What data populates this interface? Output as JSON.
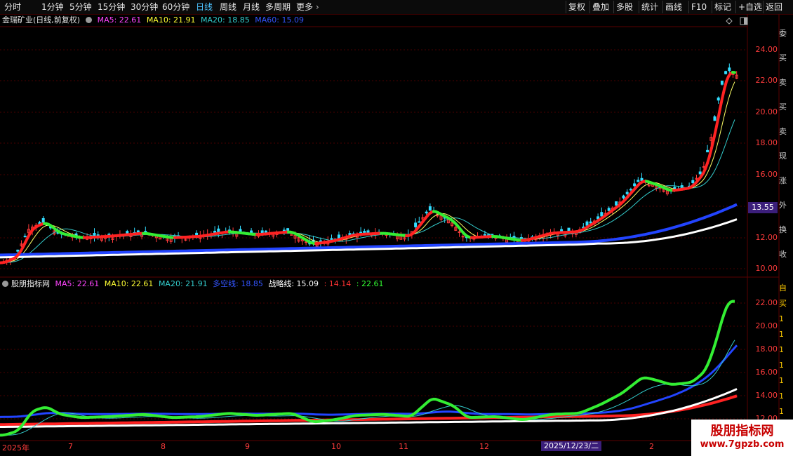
{
  "toolbar": {
    "tabs": [
      "分时",
      "1分钟",
      "5分钟",
      "15分钟",
      "30分钟",
      "60分钟",
      "日线",
      "周线",
      "月线",
      "多周期",
      "更多"
    ],
    "active_tab": "日线",
    "right_buttons": [
      "复权",
      "叠加",
      "多股",
      "统计",
      "画线",
      "F10",
      "标记",
      "+自选",
      "返回"
    ]
  },
  "main_legend": {
    "title": "金瑞矿业(日线,前复权)",
    "items": [
      {
        "text": "MA5: 22.61",
        "color": "#ff44ff"
      },
      {
        "text": "MA10: 21.91",
        "color": "#ffff33"
      },
      {
        "text": "MA20: 18.85",
        "color": "#33cccc"
      },
      {
        "text": "MA60: 15.09",
        "color": "#3355ff"
      }
    ]
  },
  "sub_legend": {
    "title": "股朋指标网",
    "items": [
      {
        "text": "MA5: 22.61",
        "color": "#ff44ff"
      },
      {
        "text": "MA10: 22.61",
        "color": "#ffff33"
      },
      {
        "text": "MA20: 21.91",
        "color": "#33cccc"
      },
      {
        "text": "多空线: 18.85",
        "color": "#3355ff"
      },
      {
        "text": "战略线: 15.09",
        "color": "#ffffff"
      },
      {
        "text": ": 14.14",
        "color": "#ff3333"
      },
      {
        "text": ": 22.61",
        "color": "#33ff33"
      }
    ]
  },
  "main_axis": [
    "24.00",
    "22.00",
    "20.00",
    "18.00",
    "16.00",
    "14.00",
    "12.00",
    "10.00"
  ],
  "sub_axis": [
    "22.00",
    "20.00",
    "18.00",
    "16.00",
    "14.00",
    "12.00"
  ],
  "current_price_tag": "13.55",
  "dates": [
    "2025年",
    "7",
    "8",
    "9",
    "10",
    "11",
    "12",
    "2"
  ],
  "cursor_date": "2025/12/23/二",
  "watermark": {
    "title": "股朋指标网",
    "url": "www.7gpzb.com"
  },
  "right_edge_main": [
    "委",
    "买",
    "卖",
    "买",
    "卖",
    "现",
    "涨",
    "外",
    "换",
    "收"
  ],
  "right_edge_sub": [
    "自",
    "买",
    "1",
    "1",
    "1",
    "1",
    "1",
    "1",
    "1",
    "1"
  ]
}
